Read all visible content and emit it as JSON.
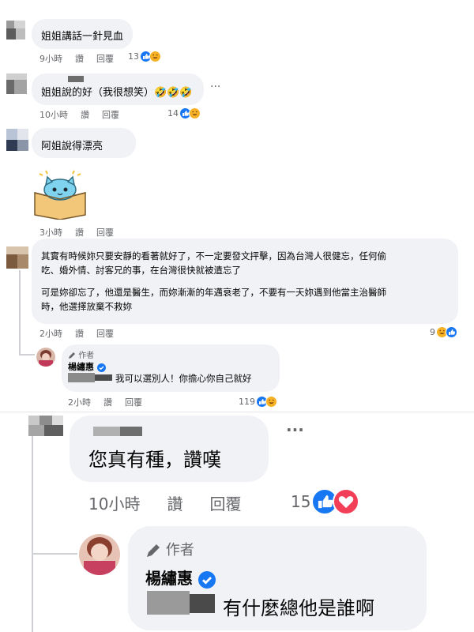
{
  "comments": [
    {
      "text": "姐姐講話一針見血",
      "time": "9小時",
      "like": "讚",
      "reply": "回覆",
      "count": "13"
    },
    {
      "text": "姐姐說的好（我很想笑）🤣🤣🤣",
      "time": "10小時",
      "like": "讚",
      "reply": "回覆",
      "count": "14"
    },
    {
      "text": "阿姐說得漂亮",
      "time": "3小時",
      "like": "讚",
      "reply": "回覆"
    },
    {
      "text_line1": "其實有時候妳只要安靜的看著就好了，不一定要發文抨擊，因為台灣人很健忘，任何偷",
      "text_line2": "吃、婚外情、討客兄的事，在台灣很快就被遺忘了",
      "text_line3": "可是妳卻忘了，他還是醫生，而妳漸漸的年邁衰老了，不要有一天妳遇到他當主治醫師",
      "text_line4": "時，他選擇放棄不救妳",
      "time": "2小時",
      "like": "讚",
      "reply": "回覆",
      "count": "9"
    },
    {
      "author_tag": "作者",
      "author": "楊繡惠",
      "text": "我可以選別人！你擔心你自己就好",
      "time": "2小時",
      "like": "讚",
      "reply": "回覆",
      "count": "119"
    },
    {
      "text": "您真有種，讚嘆",
      "time": "10小時",
      "like": "讚",
      "reply": "回覆",
      "count": "15"
    },
    {
      "author_tag": "作者",
      "author": "楊繡惠",
      "text": "有什麼總他是誰啊"
    }
  ],
  "more_label": "···",
  "icons": {
    "like": "thumbs-up-icon",
    "haha": "laughing-face-icon",
    "love": "heart-icon",
    "pen": "pen-icon",
    "verified": "verified-check-icon",
    "sticker": "cat-in-box-sticker"
  }
}
